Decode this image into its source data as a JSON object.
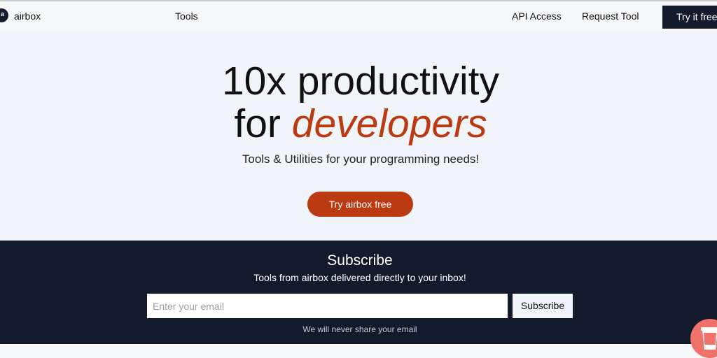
{
  "nav": {
    "brand": "airbox",
    "logo_letter": "a",
    "links": {
      "tools": "Tools",
      "api": "API Access",
      "request": "Request Tool"
    },
    "cta": "Try it free"
  },
  "hero": {
    "line1": "10x productivity",
    "line2_prefix": "for",
    "line2_accent": "developers",
    "subtitle": "Tools & Utilities for your programming needs!",
    "button": "Try airbox free"
  },
  "subscribe": {
    "title": "Subscribe",
    "text": "Tools from airbox delivered directly to your inbox!",
    "email_placeholder": "Enter your email",
    "email_value": "",
    "button": "Subscribe",
    "privacy": "We will never share your email"
  },
  "widget": {
    "icon": "coffee-cup-icon"
  },
  "colors": {
    "accent": "#bb3a12",
    "dark": "#131a2c",
    "background": "#f1f4f8",
    "widget": "#f0716a"
  }
}
